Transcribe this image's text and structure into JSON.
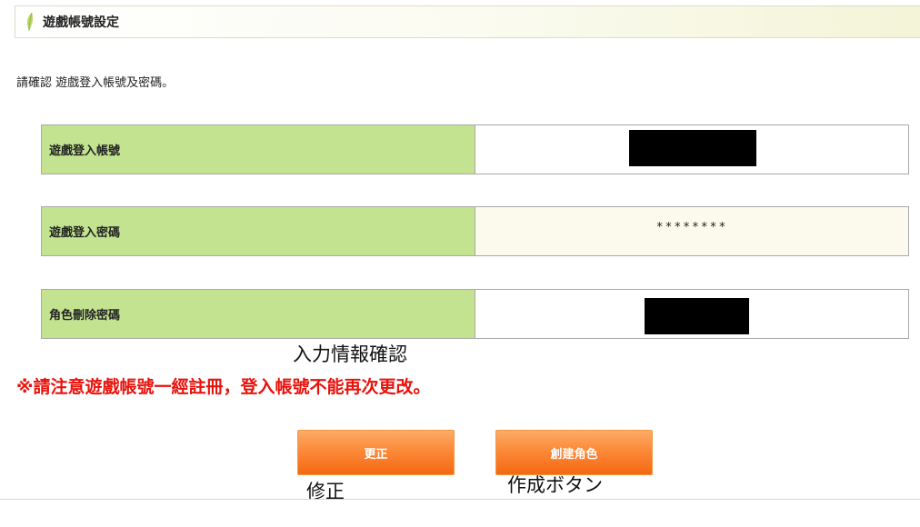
{
  "header": {
    "title": "遊戲帳號設定",
    "icon": "leaf-icon"
  },
  "instruction": "請確認 遊戲登入帳號及密碼。",
  "fields": [
    {
      "label": "遊戲登入帳號",
      "value_redacted": true
    },
    {
      "label": "遊戲登入密碼",
      "value": "********"
    },
    {
      "label": "角色刪除密碼",
      "value_redacted": true
    }
  ],
  "annotations": {
    "confirm_info": "入力情報確認",
    "modify": "修正",
    "create_button": "作成ボタン"
  },
  "warning": "※請注意遊戲帳號一經註冊，登入帳號不能再次更改。",
  "buttons": {
    "modify_label": "更正",
    "create_label": "創建角色"
  },
  "colors": {
    "label_bg": "#c3e390",
    "password_bg": "#fbfaec",
    "warning": "#e8120c",
    "button": "#f97a2a"
  }
}
